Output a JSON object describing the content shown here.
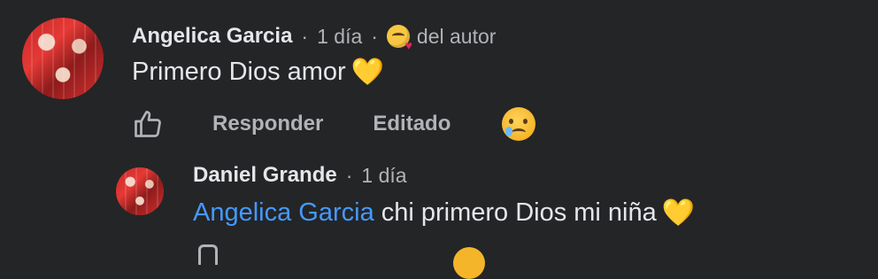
{
  "comment": {
    "author": "Angelica Garcia",
    "time": "1 día",
    "separator": "·",
    "author_badge_text": "del autor",
    "text": "Primero Dios amor",
    "emoji": "💛",
    "actions": {
      "respond": "Responder",
      "edited": "Editado"
    },
    "reaction_icon": "sad-tear-face-icon"
  },
  "reply": {
    "author": "Daniel Grande",
    "time": "1 día",
    "separator": "·",
    "mention": "Angelica Garcia",
    "text": "chi primero Dios mi niña",
    "emoji": "💛"
  },
  "colors": {
    "background": "#242526",
    "primary_text": "#e4e6eb",
    "secondary_text": "#b0b3b8",
    "mention": "#4599ff",
    "heart": "#f7b81c"
  }
}
